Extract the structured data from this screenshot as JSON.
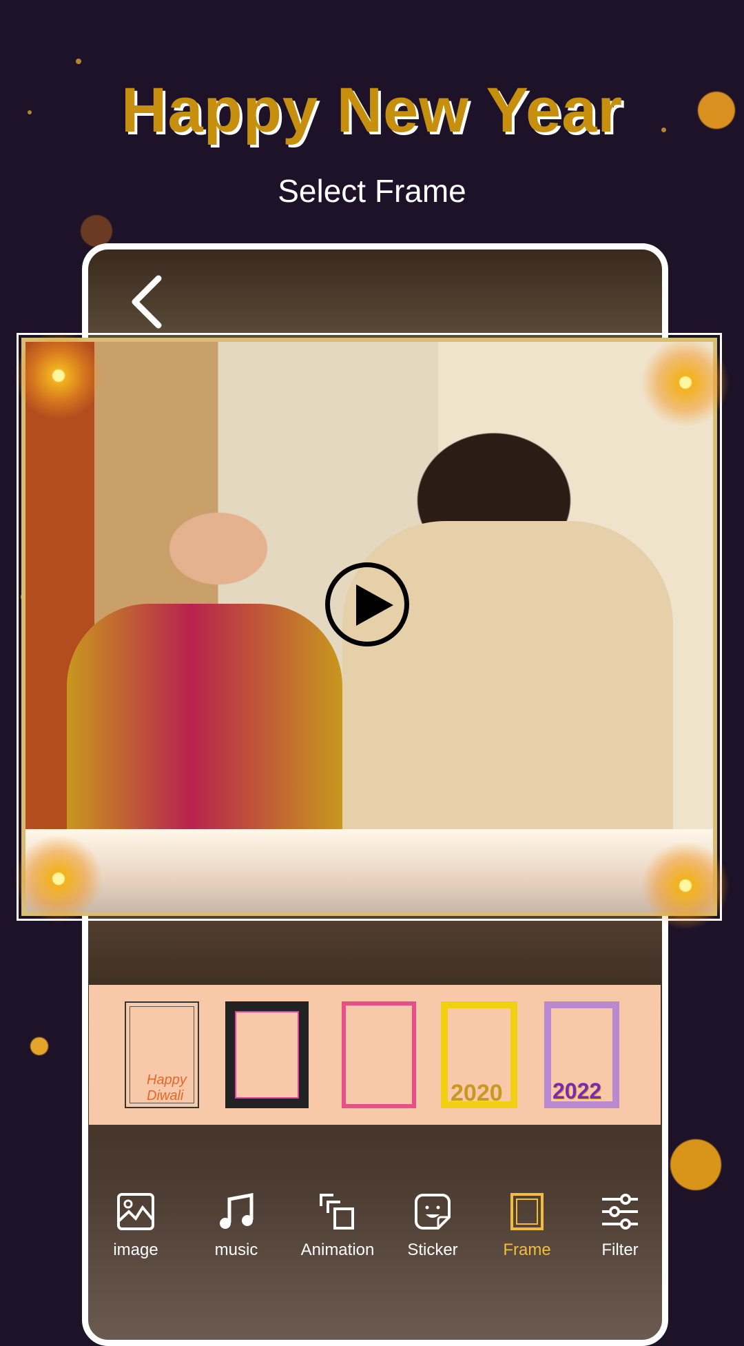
{
  "header": {
    "title": "Happy New Year",
    "subtitle": "Select Frame"
  },
  "colors": {
    "title_gold": "#c78f0e",
    "strip_bg": "#f8c9a9",
    "active_tool": "#f2be3a"
  },
  "preview": {
    "back_icon": "chevron-left-icon",
    "play_icon": "play-icon"
  },
  "frames": [
    {
      "name": "diwali-ornate-frame",
      "label": "Happy Diwali"
    },
    {
      "name": "stars-fireworks-frame"
    },
    {
      "name": "pink-frame"
    },
    {
      "name": "yellow-2020-frame",
      "label": "2020"
    },
    {
      "name": "purple-2022-frame",
      "label": "2022"
    }
  ],
  "toolbar": {
    "items": [
      {
        "label": "image",
        "icon": "image-icon"
      },
      {
        "label": "music",
        "icon": "music-note-icon"
      },
      {
        "label": "Animation",
        "icon": "animation-icon"
      },
      {
        "label": "Sticker",
        "icon": "sticker-icon"
      },
      {
        "label": "Frame",
        "icon": "frame-icon",
        "active": true
      },
      {
        "label": "Filter",
        "icon": "sliders-icon"
      }
    ]
  }
}
